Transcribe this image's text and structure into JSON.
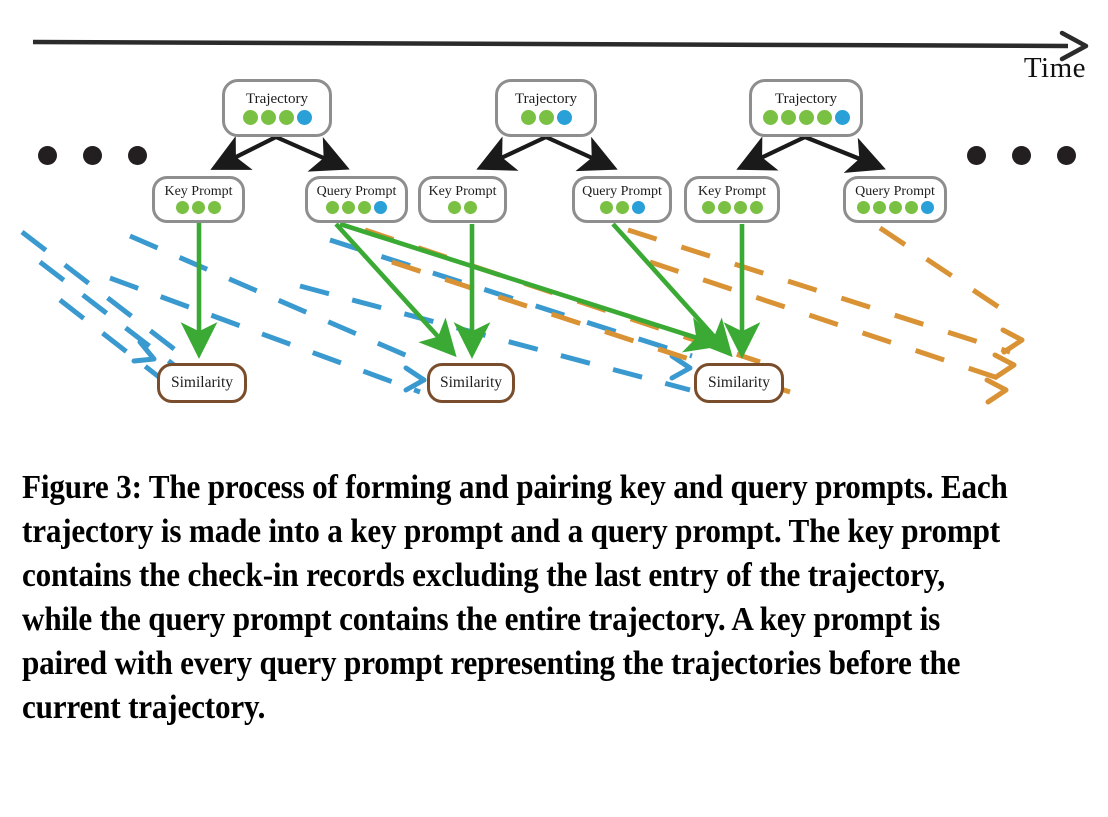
{
  "figure": {
    "time_axis": {
      "label": "Time"
    },
    "ellipsis_left": {
      "count": 3
    },
    "ellipsis_right": {
      "count": 3
    },
    "colors": {
      "green_dot": "#7ac143",
      "blue_dot": "#2aa0d8",
      "node_border": "#8e8e8e",
      "similarity_border": "#7a4e2c",
      "green_arrow": "#3aaa35",
      "blue_dashed": "#3a9ad0",
      "orange_dashed": "#d99234",
      "black_arrow": "#1a1a1a",
      "ellipsis_dot": "#231f20"
    },
    "trajectories": [
      {
        "label": "Trajectory",
        "dots": [
          "green",
          "green",
          "green",
          "blue"
        ]
      },
      {
        "label": "Trajectory",
        "dots": [
          "green",
          "green",
          "blue"
        ]
      },
      {
        "label": "Trajectory",
        "dots": [
          "green",
          "green",
          "green",
          "green",
          "blue"
        ]
      }
    ],
    "prompts": [
      {
        "label": "Key Prompt",
        "dots": [
          "green",
          "green",
          "green"
        ]
      },
      {
        "label": "Query Prompt",
        "dots": [
          "green",
          "green",
          "green",
          "blue"
        ]
      },
      {
        "label": "Key Prompt",
        "dots": [
          "green",
          "green"
        ]
      },
      {
        "label": "Query Prompt",
        "dots": [
          "green",
          "green",
          "blue"
        ]
      },
      {
        "label": "Key Prompt",
        "dots": [
          "green",
          "green",
          "green",
          "green"
        ]
      },
      {
        "label": "Query Prompt",
        "dots": [
          "green",
          "green",
          "green",
          "green",
          "blue"
        ]
      }
    ],
    "similarities": [
      {
        "label": "Similarity"
      },
      {
        "label": "Similarity"
      },
      {
        "label": "Similarity"
      }
    ]
  },
  "caption": {
    "text": "Figure 3: The process of forming and pairing key and query prompts. Each trajectory is made into a key prompt and a query prompt. The key prompt contains the check-in records excluding the last entry of the trajectory, while the query prompt contains the entire trajectory. A key prompt is paired with every query prompt representing the trajectories before the current trajectory."
  }
}
